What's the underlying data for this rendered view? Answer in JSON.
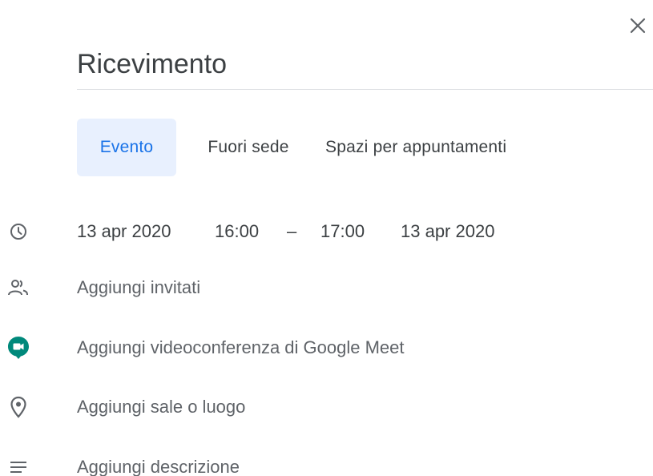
{
  "dialog": {
    "close_icon": "close-icon",
    "title_value": "Ricevimento"
  },
  "tabs": [
    {
      "label": "Evento",
      "active": true
    },
    {
      "label": "Fuori sede",
      "active": false
    },
    {
      "label": "Spazi per appuntamenti",
      "active": false
    }
  ],
  "datetime": {
    "start_date": "13 apr 2020",
    "start_time": "16:00",
    "separator": "–",
    "end_time": "17:00",
    "end_date": "13 apr 2020",
    "icon": "clock-icon"
  },
  "options": {
    "guests": {
      "label": "Aggiungi invitati",
      "icon": "people-icon"
    },
    "meet": {
      "label": "Aggiungi videoconferenza di Google Meet",
      "icon": "google-meet-icon"
    },
    "location": {
      "label": "Aggiungi sale o luogo",
      "icon": "location-pin-icon"
    },
    "description": {
      "label": "Aggiungi descrizione",
      "icon": "description-lines-icon"
    }
  },
  "colors": {
    "accent": "#1a73e8",
    "accent_bg": "#e8f0fe",
    "text_primary": "#3c4043",
    "text_secondary": "#5f6368",
    "meet_green": "#00897b",
    "divider": "#dadce0"
  }
}
